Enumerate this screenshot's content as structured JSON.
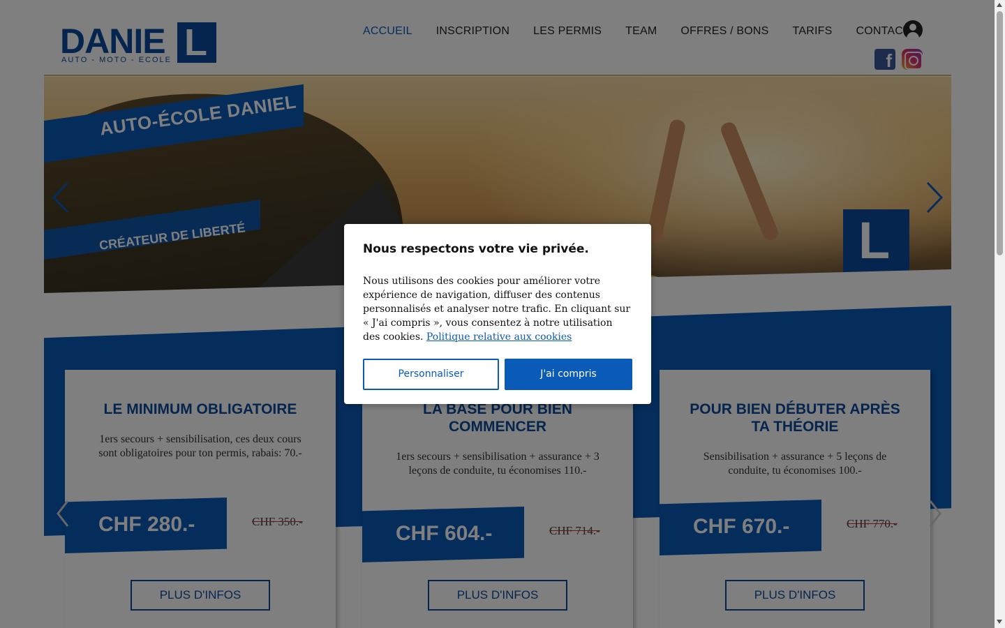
{
  "header": {
    "logo_text": "DANIE",
    "logo_box_letter": "L",
    "logo_subtitle": "AUTO - MOTO - ECOLE",
    "nav": [
      {
        "label": "ACCUEIL",
        "active": true
      },
      {
        "label": "INSCRIPTION",
        "active": false
      },
      {
        "label": "LES PERMIS",
        "active": false
      },
      {
        "label": "TEAM",
        "active": false
      },
      {
        "label": "OFFRES / BONS",
        "active": false
      },
      {
        "label": "TARIFS",
        "active": false
      },
      {
        "label": "CONTACT",
        "active": false
      }
    ],
    "icons": {
      "account": "user-account-icon",
      "facebook": "facebook-icon",
      "instagram": "instagram-icon"
    },
    "facebook_glyph": "f"
  },
  "hero": {
    "banner_title": "AUTO-ÉCOLE DANIEL",
    "banner_subtitle": "CRÉATEUR DE LIBERTÉ",
    "logo_letter": "L"
  },
  "offers": [
    {
      "title": "LE MINIMUM OBLIGATOIRE",
      "description": "1ers secours + sensibilisation, ces deux cours sont obligatoires pour ton permis, rabais: 70.-",
      "price": "CHF 280.-",
      "old_price": "CHF 350.-",
      "button": "PLUS D'INFOS"
    },
    {
      "title": "LA BASE POUR BIEN COMMENCER",
      "description": "1ers secours + sensibilisation + assurance + 3 leçons de conduite, tu économises 110.-",
      "price": "CHF 604.-",
      "old_price": "CHF 714.-",
      "button": "PLUS D'INFOS"
    },
    {
      "title": "POUR BIEN DÉBUTER APRÈS TA THÉORIE",
      "description": "Sensibilisation + assurance + 5 leçons de conduite, tu économises 100.-",
      "price": "CHF 670.-",
      "old_price": "CHF 770.-",
      "button": "PLUS D'INFOS"
    }
  ],
  "cookie_modal": {
    "title": "Nous respectons votre vie privée.",
    "text": "Nous utilisons des cookies pour améliorer votre expérience de navigation, diffuser des contenus personnalisés et analyser notre trafic. En cliquant sur « J'ai compris », vous consentez à notre utilisation des cookies.",
    "link": "Politique relative aux cookies",
    "btn_customize": "Personnaliser",
    "btn_accept": "J'ai compris"
  },
  "colors": {
    "brand_blue": "#0a5ab8",
    "brand_dark_blue": "#0a4a9c",
    "strike_red": "#d12a2a"
  }
}
